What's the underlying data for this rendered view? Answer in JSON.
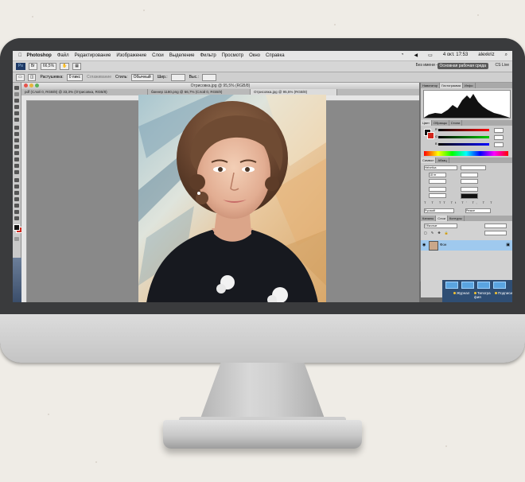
{
  "menubar": {
    "app_name": "Photoshop",
    "items": [
      "Файл",
      "Редактирование",
      "Изображение",
      "Слои",
      "Выделение",
      "Фильтр",
      "Просмотр",
      "Окно",
      "Справка"
    ],
    "clock": "4 окт. 17:53",
    "user": "alexkriz"
  },
  "options_bar": {
    "zoom": "66,5%",
    "feather_label": "Растушевка:",
    "feather_value": "0 пикс",
    "smooth_label": "Сглаживание",
    "style_label": "Стиль:",
    "style_value": "Обычный",
    "width_label": "Шир.:",
    "height_label": "Выс.:",
    "noname_label": "Без имени - 1",
    "workspace_label": "Основная рабочая среда",
    "cs_live": "CS Live"
  },
  "document": {
    "window_title": "Отрисовка.jpg @ 95,5% (RGB/8)",
    "tabs": [
      "pdf (Слой 0, RGB/8) @ 33,3% (Отрисовка, RGB/8)",
      "баннер 1180.png @ 66,7% (Слой 0, RGB/8)",
      "Отрисовка.jpg @ 95,5% (RGB/8)"
    ]
  },
  "panels": {
    "top_tabs": [
      "Навигатор",
      "Гистограмма",
      "Инфо"
    ],
    "color_tabs": [
      "Цвет",
      "Образцы",
      "Стили"
    ],
    "color_channels": [
      "R",
      "G",
      "B"
    ],
    "char_tabs": [
      "Символ",
      "Абзац"
    ],
    "font_name": "Helvetica",
    "font_size": "18 пт",
    "layers_tabs": [
      "Каналы",
      "Слои",
      "Контуры"
    ],
    "blend_mode": "Обычные",
    "layer_name": "Фон",
    "language": "Русский",
    "antialias": "Резкое"
  },
  "bridge": {
    "items": [
      "Журнал",
      "Типогра фия",
      "Подписи"
    ]
  },
  "colors": {
    "accent": "#9fc9ee",
    "foreground": "#111111",
    "background_swatch": "#d0261c",
    "bridge_bg": "#2f4e74"
  }
}
